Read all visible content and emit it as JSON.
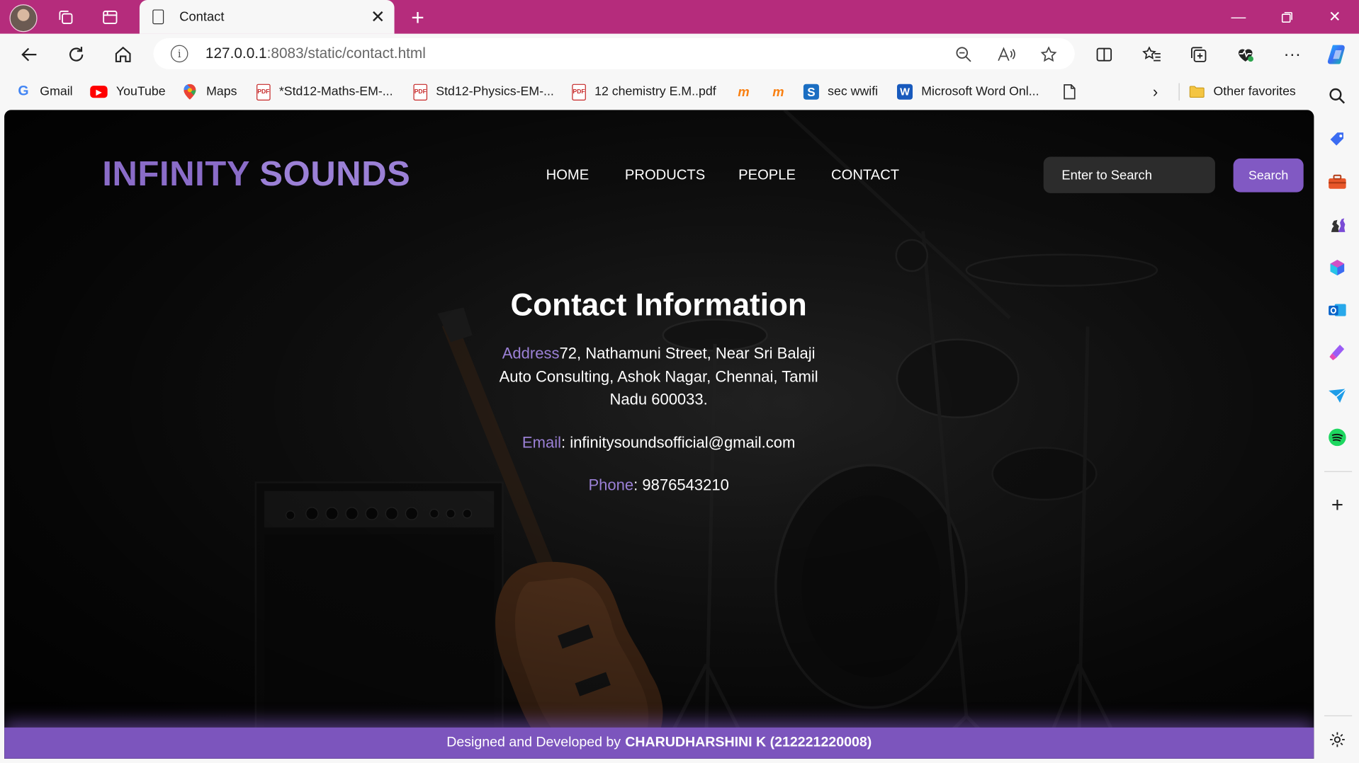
{
  "browser": {
    "tab_title": "Contact",
    "url_host": "127.0.0.1",
    "url_rest": ":8083/static/contact.html",
    "favorites": [
      {
        "label": "Gmail",
        "icon": "google-icon"
      },
      {
        "label": "YouTube",
        "icon": "youtube-icon"
      },
      {
        "label": "Maps",
        "icon": "maps-icon"
      },
      {
        "label": "*Std12-Maths-EM-...",
        "icon": "pdf-icon"
      },
      {
        "label": "Std12-Physics-EM-...",
        "icon": "pdf-icon"
      },
      {
        "label": "12 chemistry E.M..pdf",
        "icon": "pdf-icon"
      },
      {
        "label": "",
        "icon": "moodle-icon"
      },
      {
        "label": "",
        "icon": "moodle-icon"
      },
      {
        "label": "sec wwifi",
        "icon": "sway-icon"
      },
      {
        "label": "Microsoft Word Onl...",
        "icon": "word-icon"
      },
      {
        "label": "",
        "icon": "page-icon"
      }
    ],
    "other_favorites": "Other favorites"
  },
  "site": {
    "brand_first": "INFINITY",
    "brand_second": "SOUNDS",
    "nav": [
      "HOME",
      "PRODUCTS",
      "PEOPLE",
      "CONTACT"
    ],
    "search_placeholder": "Enter to Search",
    "search_button": "Search",
    "heading": "Contact Information",
    "address_label": "Address",
    "address_value": "72, Nathamuni Street, Near Sri Balaji Auto Consulting, Ashok Nagar, Chennai, Tamil Nadu 600033.",
    "email_label": "Email",
    "email_value": "infinitysoundsofficial@gmail.com",
    "phone_label": "Phone",
    "phone_value": "9876543210",
    "footer_text": "Designed and Developed by",
    "footer_author": "CHARUDHARSHINI K (212221220008)"
  },
  "colors": {
    "tabstrip": "#b52c7c",
    "brand_purple": "#8a6cc8",
    "accent_purple": "#7c55bd"
  }
}
